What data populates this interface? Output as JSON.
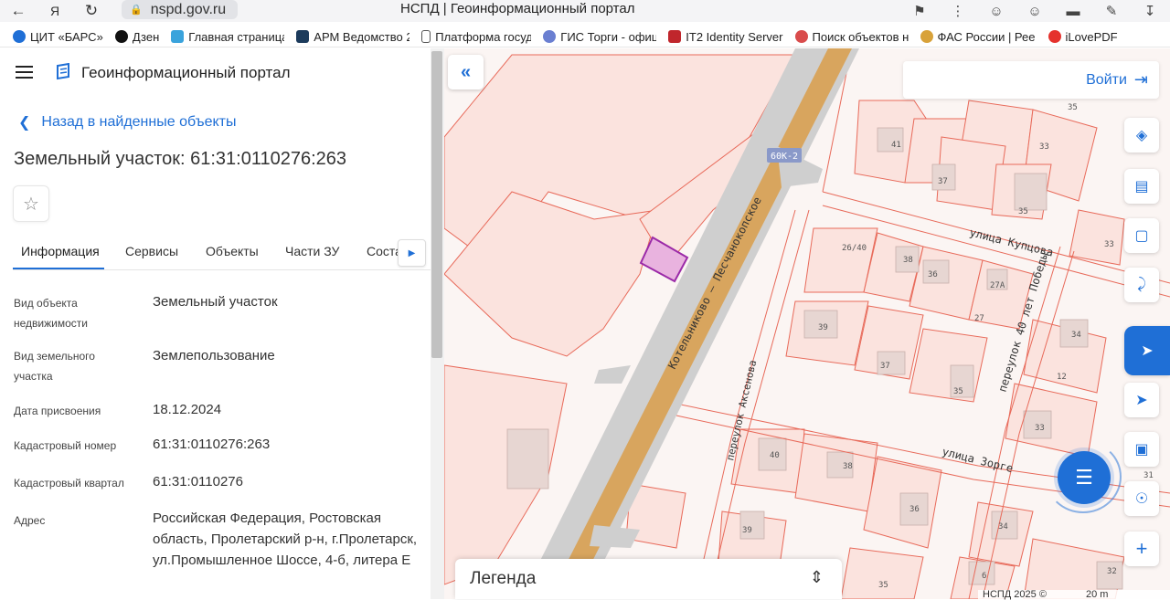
{
  "browser": {
    "url": "nspd.gov.ru",
    "tab_title": "НСПД | Геоинформационный портал",
    "bookmarks": [
      {
        "label": "ЦИТ «БАРС»",
        "color": "#1f6fd6"
      },
      {
        "label": "Дзен",
        "color": "#111111"
      },
      {
        "label": "Главная страница",
        "color": "#3aa3dc"
      },
      {
        "label": "АРМ Ведомство 2",
        "color": "#1c3b5c"
      },
      {
        "label": "Платформа госуд",
        "color": "#ffffff"
      },
      {
        "label": "ГИС Торги - офиц",
        "color": "#6a7fd1"
      },
      {
        "label": "IT2 Identity Server",
        "color": "#c0262c"
      },
      {
        "label": "Поиск объектов н",
        "color": "#d94c4c"
      },
      {
        "label": "ФАС России | Рее",
        "color": "#d8a23a"
      },
      {
        "label": "iLovePDF",
        "color": "#e5322d"
      }
    ]
  },
  "header": {
    "portal_title": "Геоинформационный портал"
  },
  "panel": {
    "back_link": "Назад в найденные объекты",
    "object_title": "Земельный участок: 61:31:0110276:263",
    "tabs": [
      "Информация",
      "Сервисы",
      "Объекты",
      "Части ЗУ",
      "Соста"
    ],
    "active_tab": "Информация",
    "fields": [
      {
        "label": "Вид объекта недвижимости",
        "value": "Земельный участок"
      },
      {
        "label": "Вид земельного участка",
        "value": "Землепользование"
      },
      {
        "label": "Дата присвоения",
        "value": "18.12.2024"
      },
      {
        "label": "Кадастровый номер",
        "value": "61:31:0110276:263"
      },
      {
        "label": "Кадастровый квартал",
        "value": "61:31:0110276"
      },
      {
        "label": "Адрес",
        "value": "Российская Федерация, Ростовская область, Пролетарский р-н, г.Пролетарск, ул.Промышленное Шоссе, 4-б, литера Е"
      }
    ]
  },
  "map": {
    "login": "Войти",
    "legend": "Легенда",
    "copyright": "НСПД 2025 ©",
    "scale": "20 m",
    "road_badge": "60К-2",
    "road_name": "Котельниково — Песчанокопское",
    "streets": [
      "улица Купцова",
      "переулок 40 лет Победы",
      "переулок Аксенова",
      "улица Зорге"
    ],
    "house_numbers": [
      "35",
      "41",
      "33",
      "37",
      "35",
      "26/40",
      "38",
      "36",
      "27А",
      "33",
      "39",
      "27",
      "34",
      "37",
      "35",
      "12",
      "33",
      "40",
      "38",
      "36",
      "34",
      "39",
      "6",
      "35",
      "32",
      "31"
    ],
    "colors": {
      "parcel_line": "#e86a5a",
      "parcel_fill": "#fbe1dc",
      "road": "#d8a55e",
      "road_edge": "#cfcfcf",
      "selected": "#9b2aa8",
      "accent": "#1f6fd6"
    }
  }
}
